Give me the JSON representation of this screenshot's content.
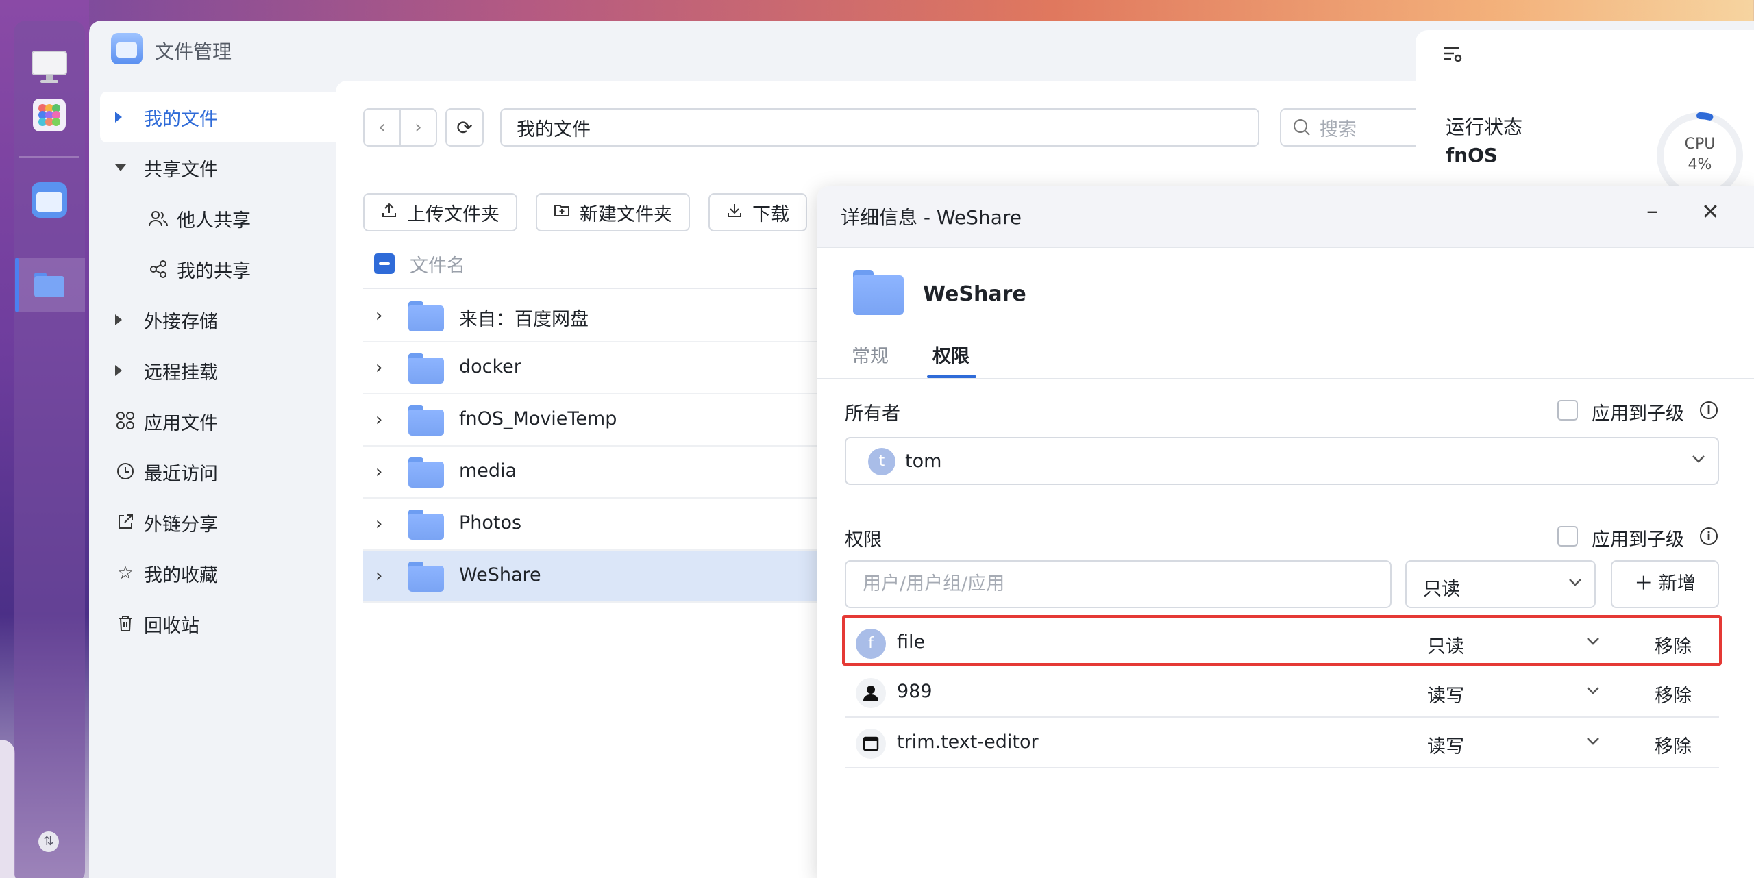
{
  "app": {
    "title": "文件管理"
  },
  "sidebar": {
    "items": [
      {
        "label": "我的文件"
      },
      {
        "label": "共享文件"
      },
      {
        "label": "他人共享"
      },
      {
        "label": "我的共享"
      },
      {
        "label": "外接存储"
      },
      {
        "label": "远程挂载"
      },
      {
        "label": "应用文件"
      },
      {
        "label": "最近访问"
      },
      {
        "label": "外链分享"
      },
      {
        "label": "我的收藏"
      },
      {
        "label": "回收站"
      }
    ]
  },
  "toolbar": {
    "path": "我的文件",
    "search_placeholder": "搜索",
    "upload_folder": "上传文件夹",
    "new_folder": "新建文件夹",
    "download": "下载"
  },
  "file_list": {
    "column_name": "文件名",
    "rows": [
      {
        "name": "来自：百度网盘"
      },
      {
        "name": "docker"
      },
      {
        "name": "fnOS_MovieTemp"
      },
      {
        "name": "media"
      },
      {
        "name": "Photos"
      },
      {
        "name": "WeShare"
      }
    ],
    "selected": "WeShare"
  },
  "widget": {
    "title": "运行状态",
    "subtitle": "fnOS",
    "cpu_label": "CPU",
    "cpu_value": "4%",
    "cpu_fraction": 0.04
  },
  "dialog": {
    "title": "详细信息 - WeShare",
    "folder_name": "WeShare",
    "tabs": {
      "general": "常规",
      "permissions": "权限"
    },
    "owner_section": "所有者",
    "apply_to_children": "应用到子级",
    "owner": {
      "initial": "t",
      "name": "tom"
    },
    "perm_section": "权限",
    "user_input_placeholder": "用户/用户组/应用",
    "mode_default": "只读",
    "add_button": "＋ 新增",
    "entries": [
      {
        "initial": "f",
        "name": "file",
        "mode": "只读",
        "remove": "移除"
      },
      {
        "initial": "",
        "name": "989",
        "mode": "读写",
        "remove": "移除"
      },
      {
        "initial": "",
        "name": "trim.text-editor",
        "mode": "读写",
        "remove": "移除"
      }
    ]
  },
  "colors": {
    "accent": "#2f6bd8",
    "highlight": "#e53935",
    "selected_row": "#dbe6f8"
  }
}
